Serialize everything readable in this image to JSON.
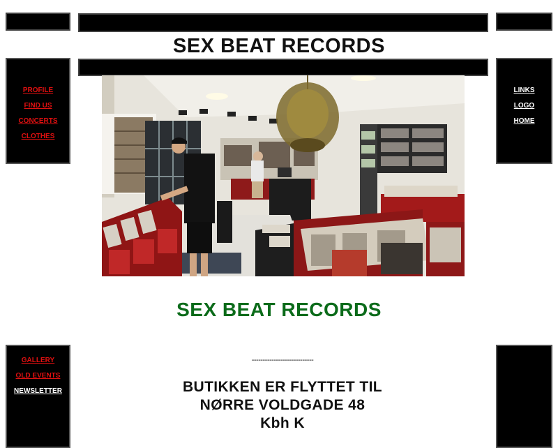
{
  "header": {
    "title": "SEX BEAT RECORDS"
  },
  "main": {
    "subtitle": "SEX BEAT RECORDS",
    "subtitle_color": "#0b6b1a",
    "divider": "----------------------------",
    "notice_lines": [
      "BUTIKKEN ER FLYTTET TIL",
      "NØRRE VOLDGADE 48",
      "Kbh K"
    ]
  },
  "left_menu_top": {
    "items": [
      {
        "label": "PROFILE"
      },
      {
        "label": "FIND US"
      },
      {
        "label": "CONCERTS"
      },
      {
        "label": "CLOTHES"
      }
    ]
  },
  "right_menu_top": {
    "items": [
      {
        "label": "LINKS"
      },
      {
        "label": "LOGO"
      },
      {
        "label": "HOME"
      }
    ]
  },
  "left_menu_bottom": {
    "items": [
      {
        "label": "GALLERY",
        "color": "red"
      },
      {
        "label": "OLD EVENTS",
        "color": "red"
      },
      {
        "label": "NEWSLETTER",
        "color": "white"
      }
    ]
  },
  "colors": {
    "link_red": "#e01010",
    "link_white": "#ffffff",
    "panel_black": "#000000"
  }
}
